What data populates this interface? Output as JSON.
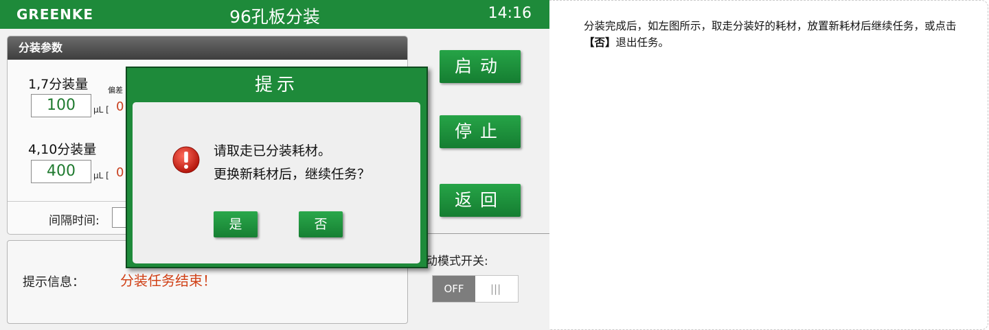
{
  "header": {
    "logo": "GREENKE",
    "title": "96孔板分装",
    "time": "14:16"
  },
  "params": {
    "header": "分装参数",
    "row1": {
      "label": "1,7分装量",
      "value": "100",
      "unit": "µL [",
      "deviation": "0",
      "deviation_label": "偏差"
    },
    "row2": {
      "label": "4,10分装量",
      "value": "400",
      "unit": "µL [",
      "deviation": "0"
    },
    "interval_label": "间隔时间:"
  },
  "buttons": {
    "start": "启动",
    "stop": "停止",
    "back": "返回"
  },
  "mode": {
    "label": "动模式开关:",
    "toggle_state": "OFF"
  },
  "info": {
    "label": "提示信息：",
    "message": "分装任务结束！"
  },
  "dialog": {
    "title": "提示",
    "line1": "请取走已分装耗材。",
    "line2": "更换新耗材后，继续任务？",
    "yes": "是",
    "no": "否"
  },
  "instruction": {
    "part1": "分装完成后，如左图所示，取走分装好的耗材，放置新耗材后继续任务，或点击",
    "emphasis": "【否】",
    "part2": "退出任务。"
  },
  "colors": {
    "brand_green": "#1e8a3a",
    "alert_red": "#d04016",
    "value_green": "#1f7a2f"
  }
}
